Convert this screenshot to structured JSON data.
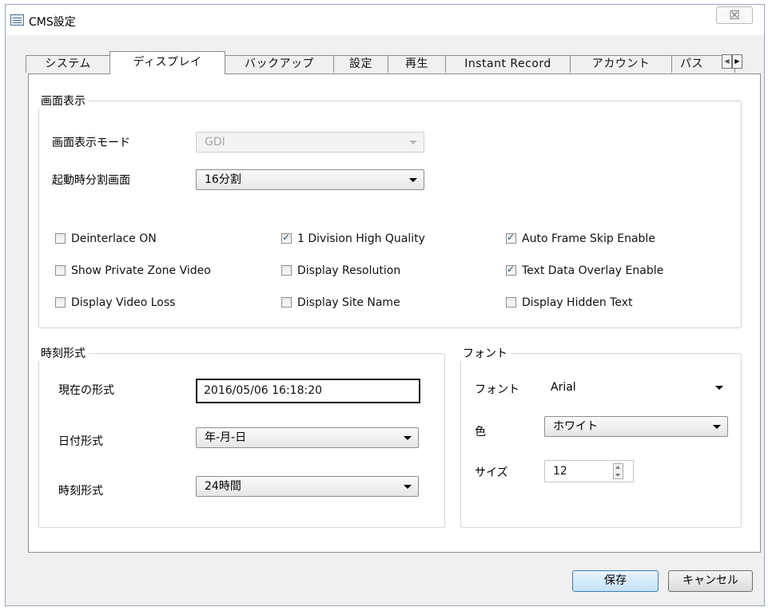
{
  "window": {
    "title": "CMS設定",
    "close_glyph": "☒"
  },
  "tabs": [
    {
      "label": "システム"
    },
    {
      "label": "ディスプレイ"
    },
    {
      "label": "バックアップ"
    },
    {
      "label": "設定"
    },
    {
      "label": "再生"
    },
    {
      "label": "Instant Record"
    },
    {
      "label": "アカウント"
    },
    {
      "label": "パス"
    }
  ],
  "active_tab": "ディスプレイ",
  "display": {
    "group_title": "画面表示",
    "mode_label": "画面表示モード",
    "mode_value": "GDI",
    "startup_label": "起動時分割画面",
    "startup_value": "16分割",
    "checkboxes": [
      {
        "label": "Deinterlace ON",
        "checked": false
      },
      {
        "label": "1 Division High Quality",
        "checked": true
      },
      {
        "label": "Auto Frame Skip Enable",
        "checked": true
      },
      {
        "label": "Show Private Zone Video",
        "checked": false
      },
      {
        "label": "Display Resolution",
        "checked": false
      },
      {
        "label": "Text Data Overlay Enable",
        "checked": true
      },
      {
        "label": "Display Video Loss",
        "checked": false
      },
      {
        "label": "Display Site Name",
        "checked": false
      },
      {
        "label": "Display Hidden Text",
        "checked": false
      }
    ]
  },
  "time": {
    "group_title": "時刻形式",
    "current_label": "現在の形式",
    "current_value": "2016/05/06 16:18:20",
    "date_label": "日付形式",
    "date_value": "年-月-日",
    "time_label": "時刻形式",
    "time_value": "24時間"
  },
  "font": {
    "group_title": "フォント",
    "font_label": "フォント",
    "font_value": "Arial",
    "color_label": "色",
    "color_value": "ホワイト",
    "size_label": "サイズ",
    "size_value": "12"
  },
  "buttons": {
    "save": "保存",
    "cancel": "キャンセル"
  }
}
